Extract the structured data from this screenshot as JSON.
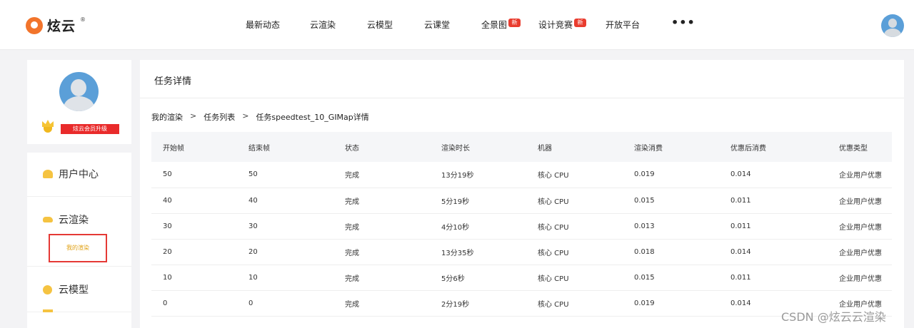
{
  "brand": {
    "name": "炫云",
    "sup": "®"
  },
  "nav": {
    "items": [
      {
        "label": "最新动态",
        "badge": ""
      },
      {
        "label": "云渲染",
        "badge": ""
      },
      {
        "label": "云模型",
        "badge": ""
      },
      {
        "label": "云课堂",
        "badge": ""
      },
      {
        "label": "全景图",
        "badge": "新"
      },
      {
        "label": "设计竞赛",
        "badge": "新"
      },
      {
        "label": "开放平台",
        "badge": ""
      }
    ],
    "more": "•••"
  },
  "user_card": {
    "vip_label": "炫云会员升级"
  },
  "sidebar": {
    "items": [
      {
        "label": "用户中心"
      },
      {
        "label": "云渲染"
      },
      {
        "label": "云模型"
      }
    ],
    "submenu_label": "我的渲染"
  },
  "main": {
    "title": "任务详情",
    "breadcrumb": [
      "我的渲染",
      "任务列表",
      "任务speedtest_10_GIMap详情"
    ],
    "breadcrumb_sep": ">",
    "table": {
      "columns": [
        "开始帧",
        "结束帧",
        "状态",
        "渲染时长",
        "机器",
        "渲染消费",
        "优惠后消费",
        "优惠类型"
      ],
      "rows": [
        [
          "50",
          "50",
          "完成",
          "13分19秒",
          "核心 CPU",
          "0.019",
          "0.014",
          "企业用户优惠"
        ],
        [
          "40",
          "40",
          "完成",
          "5分19秒",
          "核心 CPU",
          "0.015",
          "0.011",
          "企业用户优惠"
        ],
        [
          "30",
          "30",
          "完成",
          "4分10秒",
          "核心 CPU",
          "0.013",
          "0.011",
          "企业用户优惠"
        ],
        [
          "20",
          "20",
          "完成",
          "13分35秒",
          "核心 CPU",
          "0.018",
          "0.014",
          "企业用户优惠"
        ],
        [
          "10",
          "10",
          "完成",
          "5分6秒",
          "核心 CPU",
          "0.015",
          "0.011",
          "企业用户优惠"
        ],
        [
          "0",
          "0",
          "完成",
          "2分19秒",
          "核心 CPU",
          "0.019",
          "0.014",
          "企业用户优惠"
        ]
      ]
    }
  },
  "watermark": "CSDN @炫云云渲染"
}
